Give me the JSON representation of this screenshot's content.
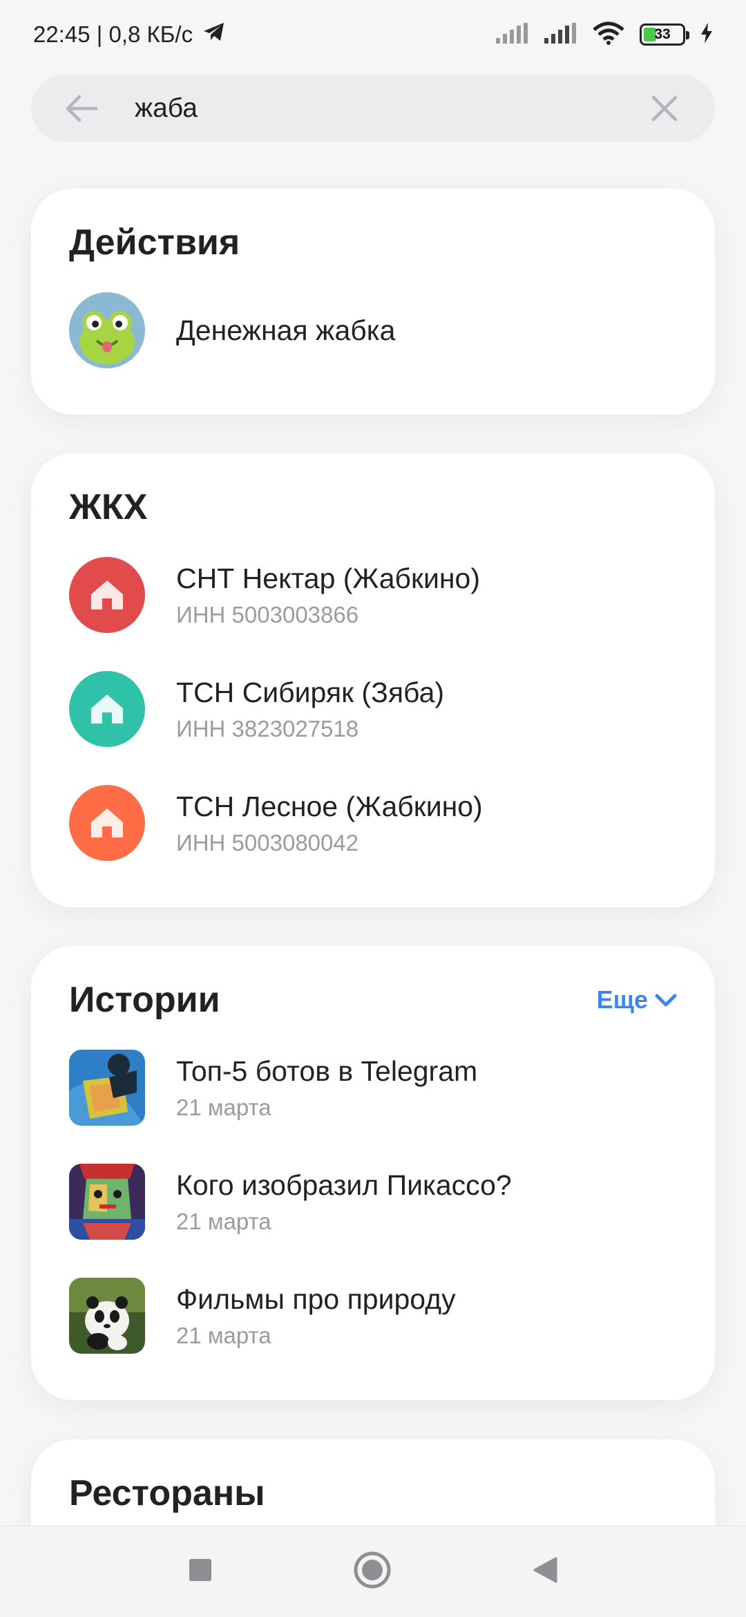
{
  "status_bar": {
    "time_speed": "22:45 | 0,8 КБ/с",
    "battery": "33"
  },
  "search": {
    "value": "жаба",
    "placeholder": ""
  },
  "actions": {
    "title": "Действия",
    "items": [
      {
        "label": "Денежная жабка",
        "icon": "frog-avatar"
      }
    ]
  },
  "utilities": {
    "title": "ЖКХ",
    "items": [
      {
        "name": "СНТ Нектар (Жабкино)",
        "inn": "ИНН 5003003866",
        "color": "#e14b4b"
      },
      {
        "name": "ТСН Сибиряк (Зяба)",
        "inn": "ИНН 3823027518",
        "color": "#2fc2a9"
      },
      {
        "name": "ТСН Лесное (Жабкино)",
        "inn": "ИНН 5003080042",
        "color": "#ff6d47"
      }
    ]
  },
  "stories": {
    "title": "Истории",
    "more_label": "Еще",
    "items": [
      {
        "title": "Топ-5 ботов в Telegram",
        "date": "21 марта"
      },
      {
        "title": "Кого изобразил Пикассо?",
        "date": "21 марта"
      },
      {
        "title": "Фильмы про природу",
        "date": "21 марта"
      }
    ]
  },
  "restaurants": {
    "title": "Рестораны"
  },
  "colors": {
    "accent": "#3f86e3",
    "background": "#f6f6f7"
  }
}
